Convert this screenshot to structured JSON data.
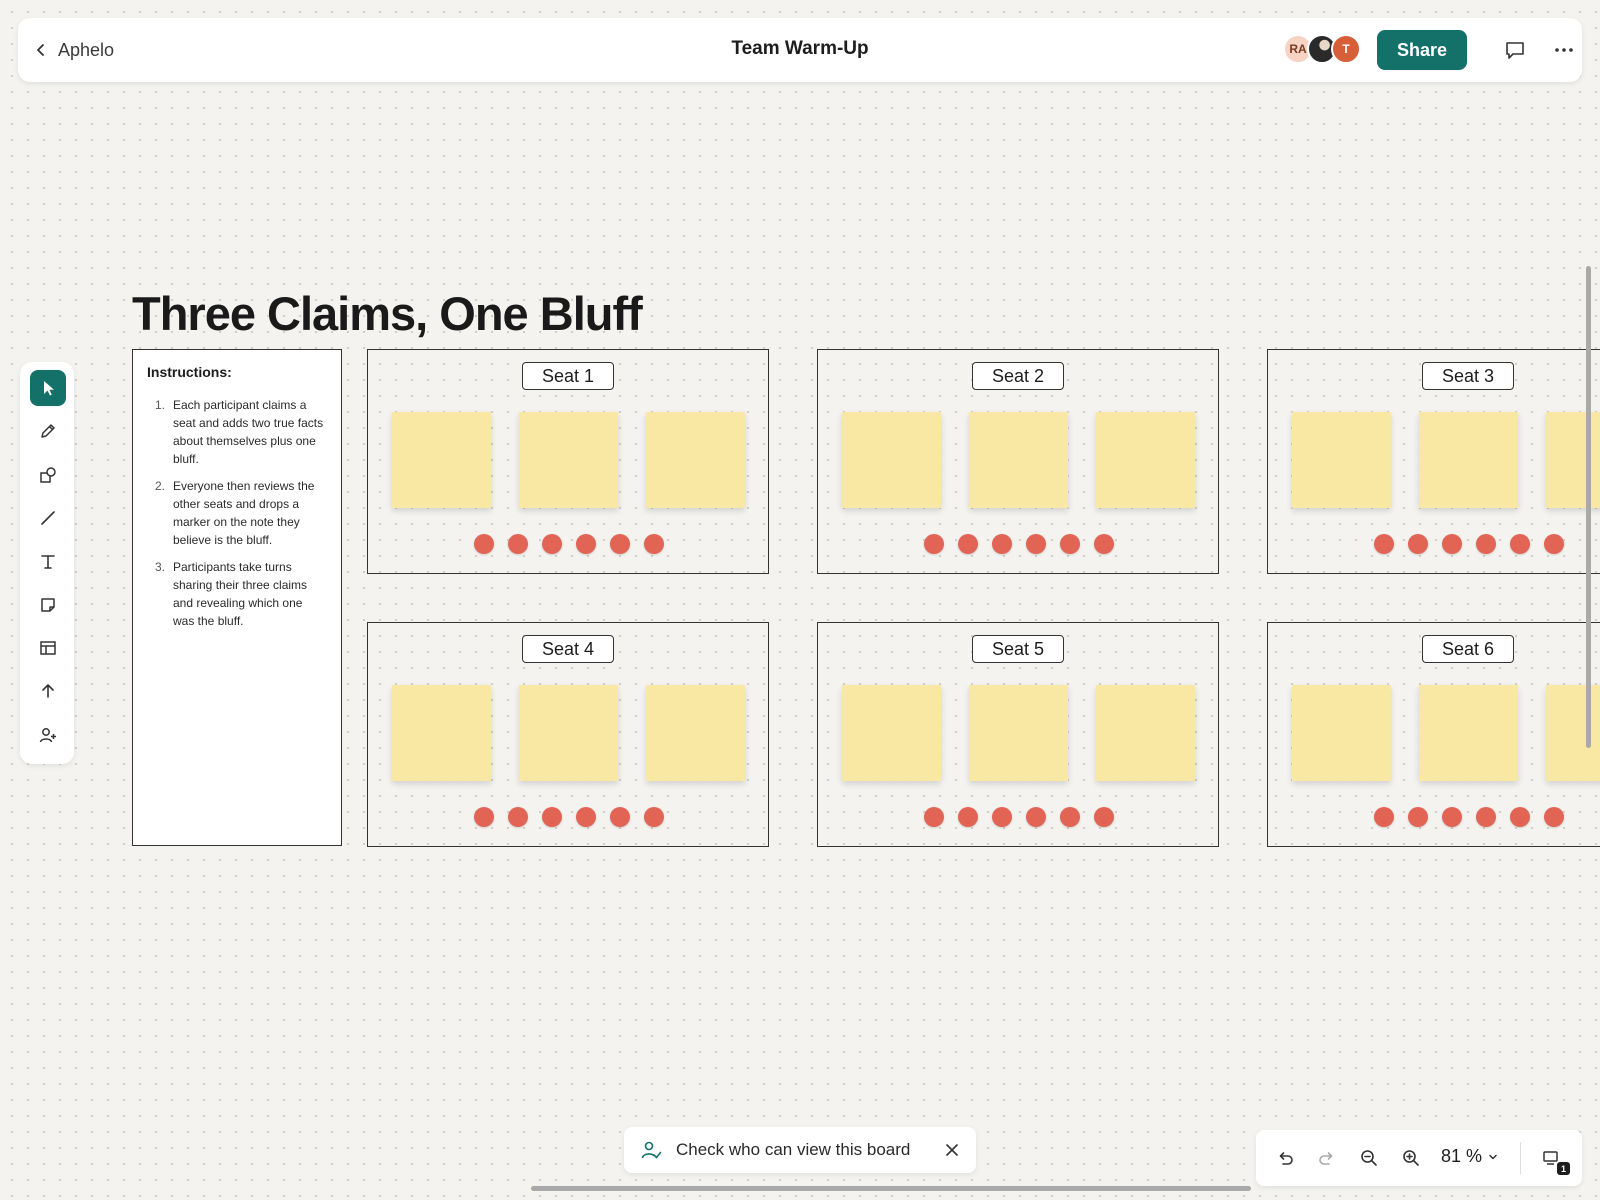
{
  "app": {
    "back_label": "Aphelo",
    "board_title": "Team Warm-Up",
    "share_label": "Share",
    "collaborators": [
      {
        "initials": "RA",
        "color": "#f6d3c4"
      },
      {
        "initials": "",
        "color": "#2a2a2a"
      },
      {
        "initials": "T",
        "color": "#d65f3a"
      }
    ],
    "accent_color": "#14716a"
  },
  "toolbar": {
    "tools": [
      "select-icon",
      "pen-icon",
      "shapes-icon",
      "line-icon",
      "text-icon",
      "sticky-note-icon",
      "template-icon",
      "upload-icon",
      "add-person-icon"
    ],
    "active_tool": "select-icon"
  },
  "board": {
    "frame_title": "Three Claims, One Bluff",
    "instructions": {
      "heading": "Instructions:",
      "steps": [
        {
          "num": "1.",
          "text": "Each participant claims a seat and adds two true facts about themselves plus one bluff."
        },
        {
          "num": "2.",
          "text": "Everyone then reviews the other seats and drops a marker on the note they believe is the bluff."
        },
        {
          "num": "3.",
          "text": "Participants take turns sharing their three claims and revealing which one was the bluff."
        }
      ]
    },
    "seats": [
      {
        "label": "Seat 1",
        "sticky_count": 3,
        "marker_count": 6
      },
      {
        "label": "Seat 2",
        "sticky_count": 3,
        "marker_count": 6
      },
      {
        "label": "Seat 3",
        "sticky_count": 3,
        "marker_count": 6
      },
      {
        "label": "Seat 4",
        "sticky_count": 3,
        "marker_count": 6
      },
      {
        "label": "Seat 5",
        "sticky_count": 3,
        "marker_count": 6
      },
      {
        "label": "Seat 6",
        "sticky_count": 3,
        "marker_count": 6
      }
    ],
    "sticky_color": "#f8e8a4",
    "marker_color": "#e26454"
  },
  "toast": {
    "text": "Check who can view this board"
  },
  "zoom": {
    "level": "81 %",
    "pages_badge": "1"
  }
}
